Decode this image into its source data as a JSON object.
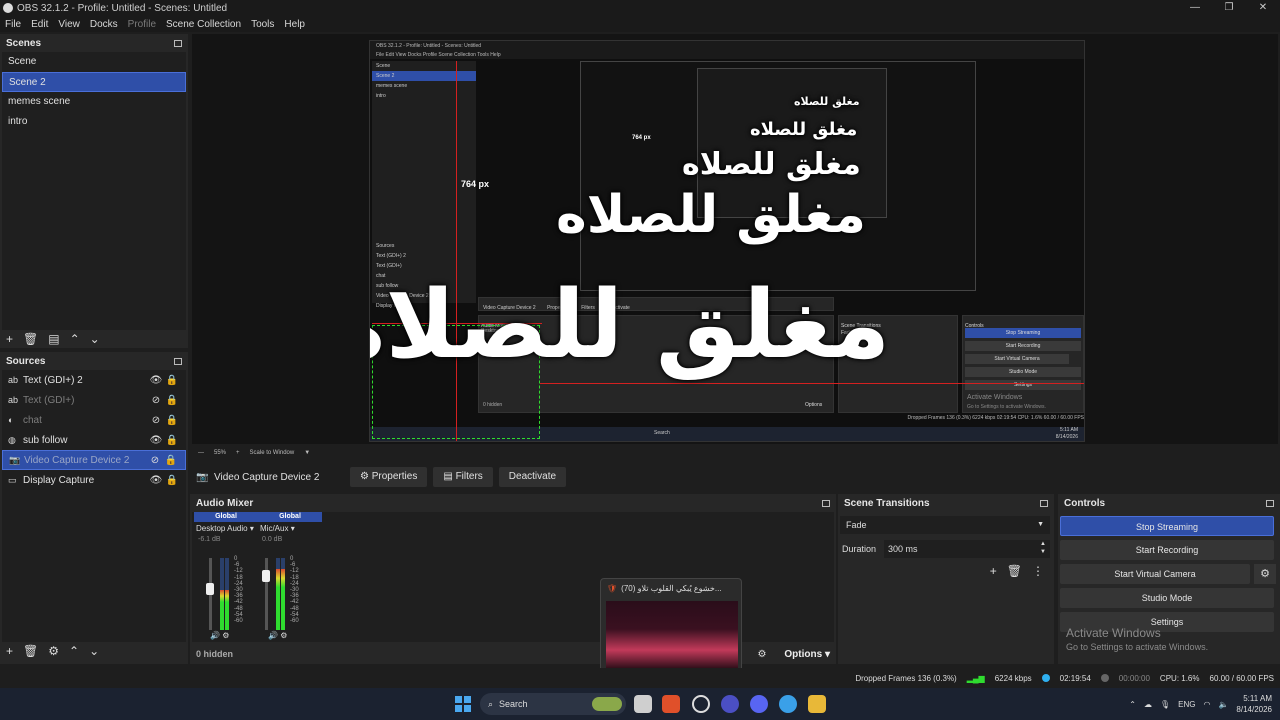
{
  "window": {
    "title": "OBS 32.1.2 - Profile: Untitled - Scenes: Untitled",
    "minimize": "—",
    "maximize": "❐",
    "close": "✕"
  },
  "menu": [
    "File",
    "Edit",
    "View",
    "Docks",
    "Profile",
    "Scene Collection",
    "Tools",
    "Help"
  ],
  "scenes": {
    "title": "Scenes",
    "items": [
      "Scene",
      "Scene 2",
      "memes scene",
      "intro"
    ],
    "selected": "Scene 2"
  },
  "sources": {
    "title": "Sources",
    "items": [
      {
        "icon": "text-icon",
        "label": "Text (GDI+) 2",
        "visible": true
      },
      {
        "icon": "text-icon",
        "label": "Text (GDI+)",
        "visible": false
      },
      {
        "icon": "audio-icon",
        "label": "chat",
        "visible": false
      },
      {
        "icon": "browser-icon",
        "label": "sub follow",
        "visible": true
      },
      {
        "icon": "camera-icon",
        "label": "Video Capture Device 2",
        "visible": false
      },
      {
        "icon": "monitor-icon",
        "label": "Display Capture",
        "visible": true
      }
    ]
  },
  "preview": {
    "overlay_text": "مغلق للصلاه",
    "dimension_label": "764 px",
    "nested_dimension_label": "764 px",
    "zoom": "55%",
    "scale_mode": "Scale to Window",
    "nested_titles": [
      "OBS 32.1.2 - Profile: Untitled - Scenes: Untitled"
    ],
    "nested_menu": "File  Edit  View  Docks  Profile  Scene Collection  Tools  Help",
    "nested_scenes": [
      "Scene",
      "Scene 2",
      "memes scene",
      "intro"
    ],
    "nested_sources_title": "Sources",
    "nested_sources": [
      "Text (GDI+) 2",
      "Text (GDI+)",
      "chat",
      "sub follow",
      "Video Capture Device 2",
      "Display Capture"
    ],
    "nested_context": [
      "Video Capture Device 2",
      "Properties",
      "Filters",
      "Deactivate"
    ],
    "nested_mixer": "Audio Mixer",
    "nested_mixer_channels": [
      "Desktop Audio",
      "Mic/Aux"
    ],
    "nested_transitions": "Scene Transitions",
    "nested_trans_value": "Fade",
    "nested_controls": "Controls",
    "nested_buttons": [
      "Stop Streaming",
      "Start Recording",
      "Start Virtual Camera",
      "Studio Mode",
      "Settings"
    ],
    "nested_activate": "Activate Windows",
    "nested_activate_sub": "Go to Settings to activate Windows.",
    "nested_hidden": "0 hidden",
    "nested_options": "Options",
    "nested_status": "Dropped Frames 136 (0.3%)   6224 kbps   02:19:54   CPU: 1.6%   60.00 / 60.00 FPS",
    "nested_search": "Search",
    "nested_clock": "5:11 AM",
    "nested_date": "8/14/2026"
  },
  "context_bar": {
    "source": "Video Capture Device 2",
    "properties": "Properties",
    "filters": "Filters",
    "deactivate": "Deactivate"
  },
  "mixer": {
    "title": "Audio Mixer",
    "channels": [
      {
        "head": "Global",
        "name": "Desktop Audio",
        "db": "-6.1 dB",
        "level": 0.55
      },
      {
        "head": "Global",
        "name": "Mic/Aux",
        "db": "0.0 dB",
        "level": 0.85
      }
    ],
    "scale": [
      "0",
      "-6",
      "-12",
      "-18",
      "-24",
      "-30",
      "-36",
      "-42",
      "-48",
      "-54",
      "-60"
    ],
    "hidden": "0 hidden",
    "options": "Options"
  },
  "transitions": {
    "title": "Scene Transitions",
    "selected": "Fade",
    "duration_label": "Duration",
    "duration_value": "300 ms"
  },
  "controls": {
    "title": "Controls",
    "buttons": [
      "Stop Streaming",
      "Start Recording",
      "Start Virtual Camera",
      "Studio Mode",
      "Settings"
    ],
    "activate_title": "Activate Windows",
    "activate_sub": "Go to Settings to activate Windows."
  },
  "status": {
    "dropped": "Dropped Frames 136 (0.3%)",
    "bitrate": "6224 kbps",
    "stream_time": "02:19:54",
    "rec_time": "00:00:00",
    "cpu": "CPU: 1.6%",
    "fps": "60.00 / 60.00 FPS"
  },
  "thumbnail": {
    "title": "(70) خشوع يُبكي القلوب تلاو..."
  },
  "taskbar": {
    "search": "Search",
    "lang": "ENG",
    "time": "5:11 AM",
    "date": "8/14/2026"
  },
  "colors": {
    "accent": "#2f4fa8",
    "meter_green": "#2fdc2f",
    "preview_guides": "#d42020"
  }
}
